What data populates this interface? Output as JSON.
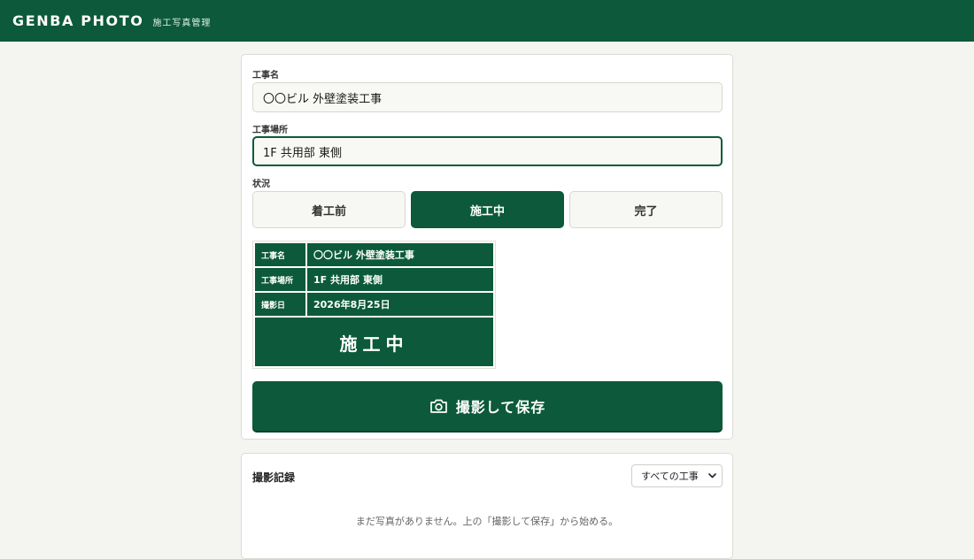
{
  "header": {
    "brand": "GENBA PHOTO",
    "subtitle": "施工写真管理"
  },
  "form": {
    "project_name": {
      "label": "工事名",
      "value": "〇〇ビル 外壁塗装工事"
    },
    "location": {
      "label": "工事場所",
      "value": "1F 共用部 東側"
    },
    "status": {
      "label": "状況",
      "options": [
        "着工前",
        "施工中",
        "完了"
      ],
      "selected": "施工中"
    }
  },
  "board": {
    "rows": [
      {
        "key": "工事名",
        "value": "〇〇ビル 外壁塗装工事"
      },
      {
        "key": "工事場所",
        "value": "1F 共用部 東側"
      },
      {
        "key": "撮影日",
        "value": "2026年8月25日"
      }
    ],
    "status": "施工中"
  },
  "capture_button": {
    "label": "撮影して保存",
    "icon": "camera-icon"
  },
  "log": {
    "title": "撮影記録",
    "filter": {
      "selected": "すべての工事",
      "options": [
        "すべての工事"
      ]
    },
    "empty_message": "まだ写真がありません。上の「撮影して保存」から始める。"
  },
  "colors": {
    "primary": "#0c5a3b",
    "background": "#f4f4f1",
    "card": "#ffffff"
  }
}
